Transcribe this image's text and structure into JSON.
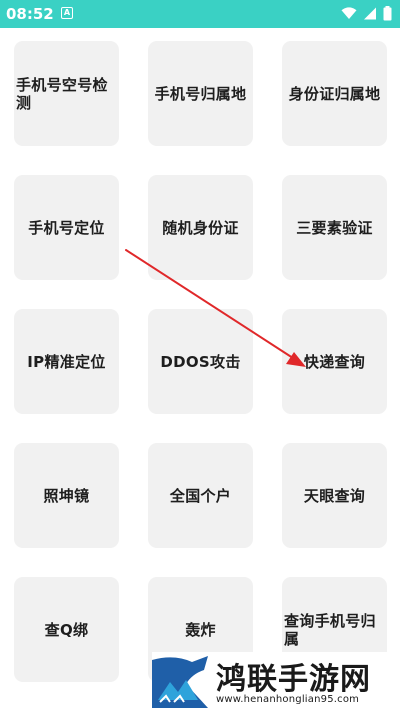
{
  "status_bar": {
    "time": "08:52",
    "app_icon": "A",
    "icons": [
      "wifi-icon",
      "signal-icon",
      "battery-icon"
    ],
    "background": "#3ad1c4"
  },
  "tiles": [
    {
      "label": "手机号空号检测"
    },
    {
      "label": "手机号归属地"
    },
    {
      "label": "身份证归属地"
    },
    {
      "label": "手机号定位"
    },
    {
      "label": "随机身份证"
    },
    {
      "label": "三要素验证"
    },
    {
      "label": "IP精准定位"
    },
    {
      "label": "DDOS攻击"
    },
    {
      "label": "快递查询"
    },
    {
      "label": "照坤镜"
    },
    {
      "label": "全国个户"
    },
    {
      "label": "天眼查询"
    },
    {
      "label": "查Q绑"
    },
    {
      "label": "轰炸"
    },
    {
      "label": "查询手机号归属"
    }
  ],
  "annotation": {
    "color": "#e0282a",
    "icon": "red-arrow"
  },
  "watermark": {
    "title": "鸿联手游网",
    "url": "www.henanhonglian95.com",
    "logo_colors": [
      "#1f5fa8",
      "#2ea3db"
    ]
  }
}
